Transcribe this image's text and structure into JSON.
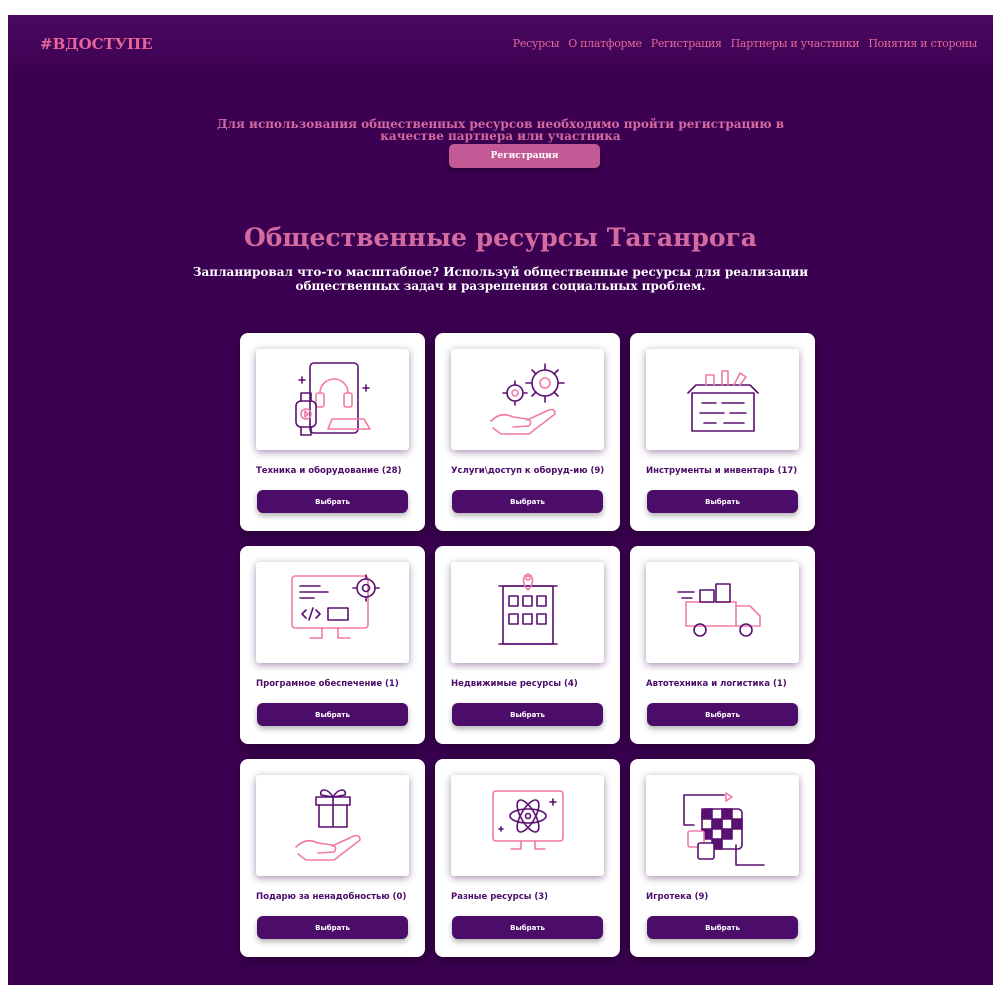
{
  "header": {
    "logo": "#ВДОСТУПЕ",
    "menu": [
      "Ресурсы",
      "О платформе",
      "Регистрация",
      "Партнеры и участники",
      "Понятия и стороны"
    ]
  },
  "notice": {
    "line1": "Для использования общественных ресурсов необходимо пройти регистрацию в",
    "line2": "качестве партнера или участника",
    "button": "Регистрация"
  },
  "main": {
    "title": "Общественные ресурсы Таганрога",
    "subtitle_line1": "Запланировал что-то масштабное? Используй общественные ресурсы для реализации",
    "subtitle_line2": "общественных задач и разрешения социальных проблем."
  },
  "cards": [
    {
      "label": "Техника и оборудование (28)",
      "button": "Выбрать",
      "icon": "devices-icon"
    },
    {
      "label": "Услуги\\доступ к оборуд-ию (9)",
      "button": "Выбрать",
      "icon": "gears-hand-icon"
    },
    {
      "label": "Инструменты и инвентарь (17)",
      "button": "Выбрать",
      "icon": "toolbox-icon"
    },
    {
      "label": "Програмное обеспечение (1)",
      "button": "Выбрать",
      "icon": "software-monitor-icon"
    },
    {
      "label": "Недвижимые ресурсы (4)",
      "button": "Выбрать",
      "icon": "building-icon"
    },
    {
      "label": "Автотехника и логистика (1)",
      "button": "Выбрать",
      "icon": "delivery-truck-icon"
    },
    {
      "label": "Подарю за ненадобностью (0)",
      "button": "Выбрать",
      "icon": "gift-hand-icon"
    },
    {
      "label": "Разные ресурсы (3)",
      "button": "Выбрать",
      "icon": "atom-monitor-icon"
    },
    {
      "label": "Игротека (9)",
      "button": "Выбрать",
      "icon": "board-game-icon"
    }
  ],
  "colors": {
    "background": "#3c0052",
    "accent": "#e8679a",
    "button": "#4c0c6a",
    "icon_pink": "#f07aa8",
    "icon_purple": "#5a1070"
  }
}
